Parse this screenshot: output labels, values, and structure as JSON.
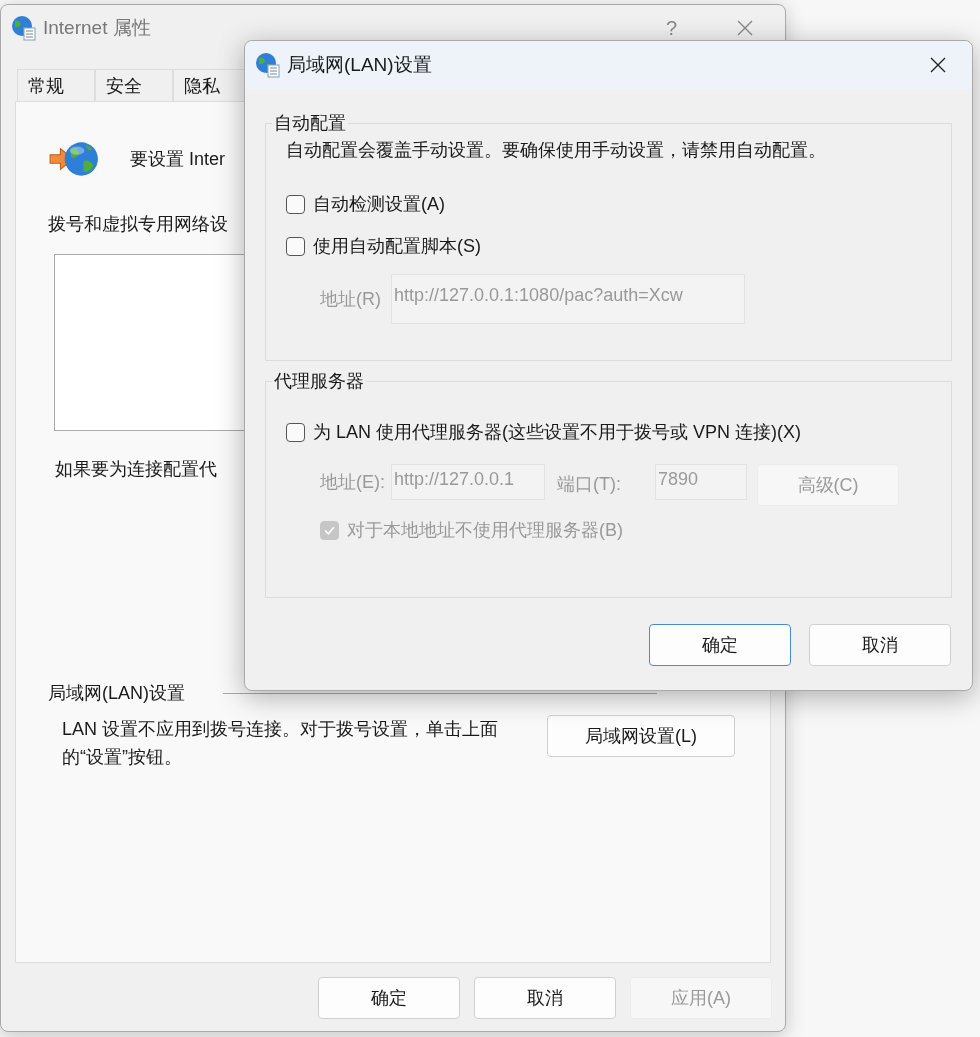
{
  "back_window": {
    "title": "Internet 属性",
    "help": "?",
    "tabs": [
      {
        "label": "常规",
        "selected": false
      },
      {
        "label": "安全",
        "selected": false
      },
      {
        "label": "隐私",
        "selected": false
      }
    ],
    "setup_text": "要设置 Inter",
    "vpn_heading": "拨号和虚拟专用网络设",
    "proxy_note": "如果要为连接配置代",
    "lan_heading": "局域网(LAN)设置",
    "lan_note": "LAN 设置不应用到拨号连接。对于拨号设置，单击上面的“设置”按钮。",
    "lan_button": "局域网设置(L)",
    "buttons": [
      {
        "label": "确定",
        "disabled": false
      },
      {
        "label": "取消",
        "disabled": false
      },
      {
        "label": "应用(A)",
        "disabled": true
      }
    ]
  },
  "dialog": {
    "title": "局域网(LAN)设置",
    "auto_config": {
      "heading": "自动配置",
      "note": "自动配置会覆盖手动设置。要确保使用手动设置，请禁用自动配置。",
      "options": [
        {
          "label": "自动检测设置(A)",
          "checked": false
        },
        {
          "label": "使用自动配置脚本(S)",
          "checked": false
        }
      ],
      "address": {
        "label": "地址(R)",
        "value": "http://127.0.0.1:1080/pac?auth=Xcw",
        "disabled": true
      }
    },
    "proxy": {
      "heading": "代理服务器",
      "use_proxy": {
        "label": "为 LAN 使用代理服务器(这些设置不用于拨号或 VPN 连接)(X)",
        "checked": false
      },
      "address": {
        "label": "地址(E):",
        "value": "http://127.0.0.1",
        "disabled": true
      },
      "port": {
        "label": "端口(T):",
        "value": "7890",
        "disabled": true
      },
      "advanced_button": {
        "label": "高级(C)",
        "disabled": true
      },
      "bypass_local": {
        "label": "对于本地地址不使用代理服务器(B)",
        "checked": true,
        "disabled": true
      }
    },
    "buttons": [
      {
        "label": "确定",
        "default": true
      },
      {
        "label": "取消",
        "default": false
      }
    ]
  }
}
